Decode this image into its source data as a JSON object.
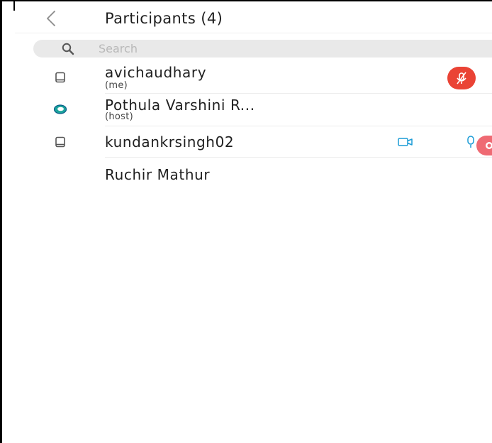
{
  "header": {
    "back_icon": "chevron-left-icon",
    "title": "Participants (4)"
  },
  "search": {
    "placeholder": "Search",
    "value": "",
    "icon": "search-icon"
  },
  "colors": {
    "mute_badge": "#ea4335",
    "record_badge": "#ef6a73",
    "accent_blue": "#1a9bd6",
    "host_ring": "#1ba39c"
  },
  "participants": [
    {
      "name": "avichaudhary",
      "role": "(me)",
      "device_icon": "tablet-icon",
      "status": [
        "muted-mic-icon"
      ]
    },
    {
      "name": "Pothula Varshini R...",
      "role": "(host)",
      "device_icon": "host-ring-icon",
      "status": []
    },
    {
      "name": "kundankrsingh02",
      "role": "",
      "device_icon": "tablet-icon",
      "status": [
        "video-camera-icon",
        "microphone-icon",
        "record-icon"
      ]
    },
    {
      "name": "Ruchir Mathur",
      "role": "",
      "device_icon": "",
      "status": []
    }
  ]
}
